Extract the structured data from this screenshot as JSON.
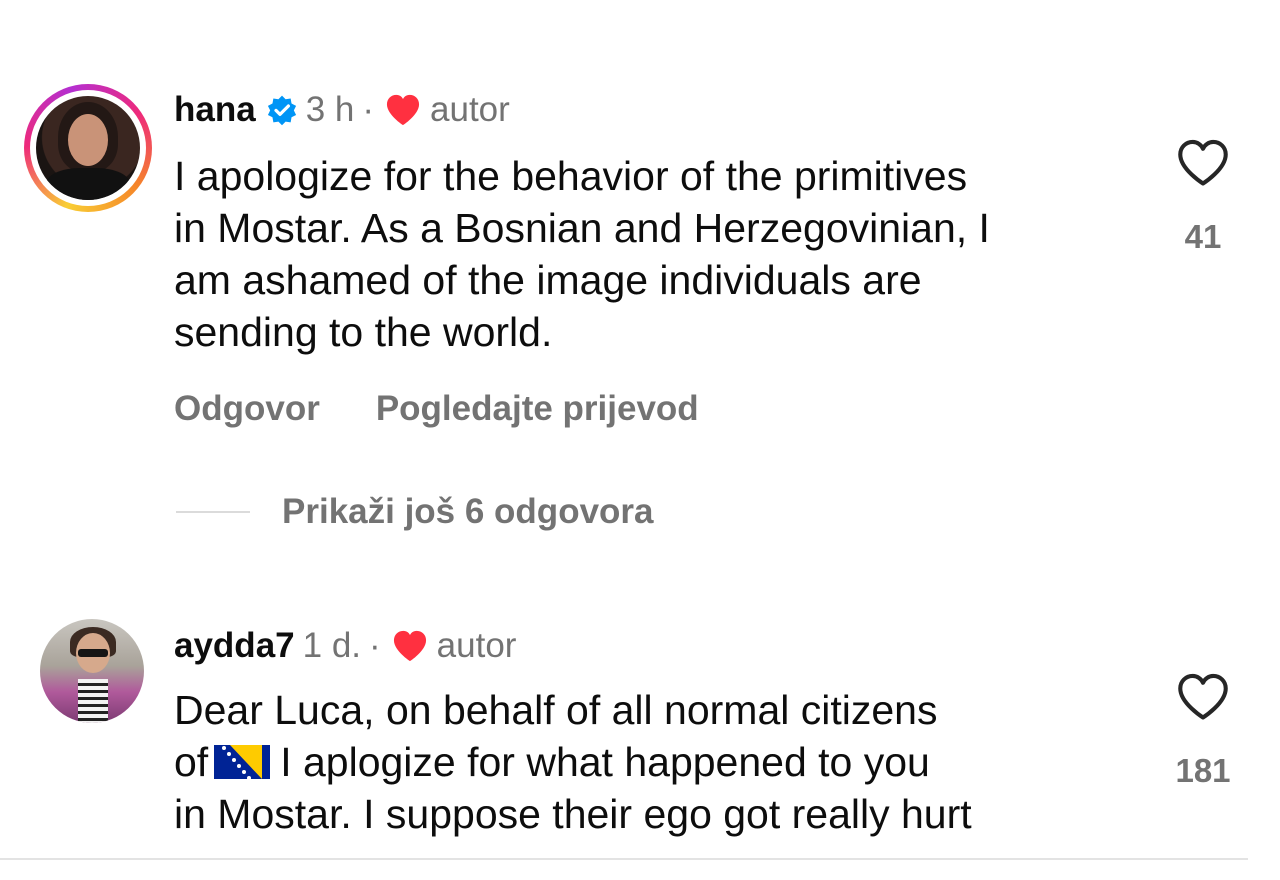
{
  "comments": [
    {
      "username": "hana",
      "verified": true,
      "time": "3 h",
      "separator": "·",
      "liked_by_author_label": "autor",
      "has_story_ring": true,
      "text_lines": [
        "I apologize for the behavior of the primitives",
        "in Mostar. As a Bosnian and Herzegovinian, I",
        "am ashamed of the image individuals are",
        "sending to the world."
      ],
      "like_count": "41",
      "actions": {
        "reply": "Odgovor",
        "translate": "Pogledajte prijevod"
      },
      "more_replies": "Prikaži još 6 odgovora"
    },
    {
      "username": "aydda7",
      "verified": false,
      "time": "1 d.",
      "separator": "·",
      "liked_by_author_label": "autor",
      "has_story_ring": false,
      "text_lines": [
        "Dear Luca, on behalf of all normal citizens",
        "I aplogize for what happened to you",
        "in Mostar. I suppose their ego got really hurt"
      ],
      "text_line2_prefix": "of",
      "flag_icon": "bosnia-herzegovina-flag",
      "like_count": "181"
    }
  ],
  "colors": {
    "secondary_text": "#737373",
    "verified_blue": "#0095f6",
    "heart_red": "#ff3040"
  }
}
